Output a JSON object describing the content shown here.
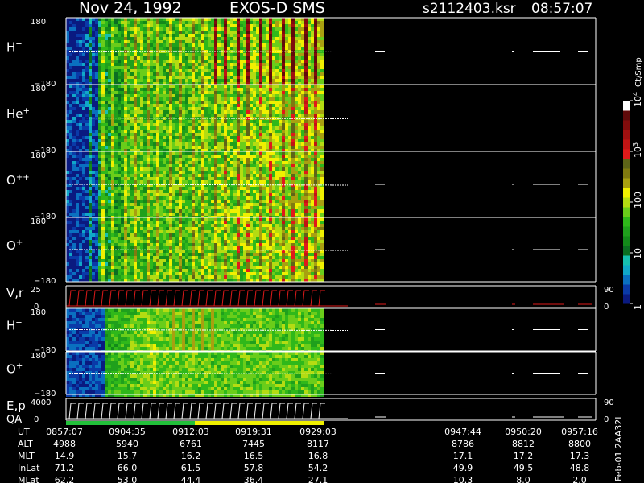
{
  "header": {
    "date": "Nov 24, 1992",
    "mission": "EXOS-D SMS",
    "file": "s2112403.ksr",
    "time": "08:57:07"
  },
  "chart_data": {
    "type": "heatmap",
    "panels": [
      {
        "id": "h",
        "label": "H",
        "sup": "+",
        "ymax": "180",
        "ymin": "−180",
        "style": "spectro",
        "extends_to_col": 402
      },
      {
        "id": "he",
        "label": "He",
        "sup": "+",
        "ymax": "180",
        "ymin": "−180",
        "style": "spectro",
        "extends_to_col": 402
      },
      {
        "id": "opp",
        "label": "O",
        "sup": "++",
        "ymax": "180",
        "ymin": "−180",
        "style": "spectro",
        "extends_to_col": 402
      },
      {
        "id": "op",
        "label": "O",
        "sup": "+",
        "ymax": "180",
        "ymin": "−180",
        "style": "spectro",
        "extends_to_col": 402
      },
      {
        "id": "vr",
        "label": "V,r",
        "sup": "",
        "ymax": "25",
        "ymin": "0",
        "right_top": "90",
        "right_bottom": "0",
        "style": "line"
      },
      {
        "id": "h2",
        "label": "H",
        "sup": "+",
        "ymax": "180",
        "ymin": "−180",
        "style": "spectro2",
        "extends_to_col": 402
      },
      {
        "id": "o2",
        "label": "O",
        "sup": "+",
        "ymax": "180",
        "ymin": "−180",
        "style": "spectro2",
        "extends_to_col": 402
      },
      {
        "id": "ep",
        "label": "E,p",
        "sup": "",
        "ylabel2": "QA",
        "ymax": "4000",
        "ymin": "0",
        "right_top": "90",
        "right_bottom": "0",
        "style": "line"
      }
    ],
    "colorbar": {
      "unit": "Ct/Smp",
      "ticks": [
        {
          "label": "1",
          "frac": 0.0
        },
        {
          "label": "10",
          "frac": 0.25
        },
        {
          "label": "100",
          "frac": 0.5
        },
        {
          "label": "10",
          "sup": "3",
          "frac": 0.75
        },
        {
          "label": "10",
          "sup": "4",
          "frac": 1.0
        }
      ],
      "colors": [
        "#0a1a80",
        "#0a3aa8",
        "#0a70c0",
        "#10a8c8",
        "#16c0b0",
        "#0b6e22",
        "#138a1a",
        "#1fa01c",
        "#2fb81a",
        "#6acd1a",
        "#b4dc12",
        "#f0f000",
        "#a8a010",
        "#807a10",
        "#5e6418",
        "#e01a1a",
        "#c01414",
        "#a01010",
        "#800c0c",
        "#600a0a",
        "#ffffff"
      ]
    },
    "axis_table": {
      "row_labels": [
        "UT",
        "ALT",
        "MLT",
        "InLat",
        "MLat"
      ],
      "columns": [
        {
          "values": [
            "0857:07",
            "4988",
            "14.9",
            "71.2",
            "62.2"
          ]
        },
        {
          "values": [
            "0904:35",
            "5940",
            "15.7",
            "66.0",
            "53.0"
          ]
        },
        {
          "values": [
            "0912:03",
            "6761",
            "16.2",
            "61.5",
            "44.4"
          ]
        },
        {
          "values": [
            "0919:31",
            "7445",
            "16.5",
            "57.8",
            "36.4"
          ]
        },
        {
          "values": [
            "0929:03",
            "8117",
            "16.8",
            "54.2",
            "27.1"
          ]
        },
        {
          "values": [
            "0947:44",
            "8786",
            "17.1",
            "49.9",
            "10.3"
          ]
        },
        {
          "values": [
            "0950:20",
            "8812",
            "17.2",
            "49.5",
            "8.0"
          ]
        },
        {
          "values": [
            "0957:16",
            "8800",
            "17.3",
            "48.8",
            "2.0"
          ]
        }
      ]
    },
    "qa_bar": [
      {
        "color": "#22c03a",
        "from": 0.0,
        "to": 0.5
      },
      {
        "color": "#f0f000",
        "from": 0.5,
        "to": 1.0
      }
    ]
  },
  "footer": {
    "stamp": "Feb-01 2AA32L"
  }
}
